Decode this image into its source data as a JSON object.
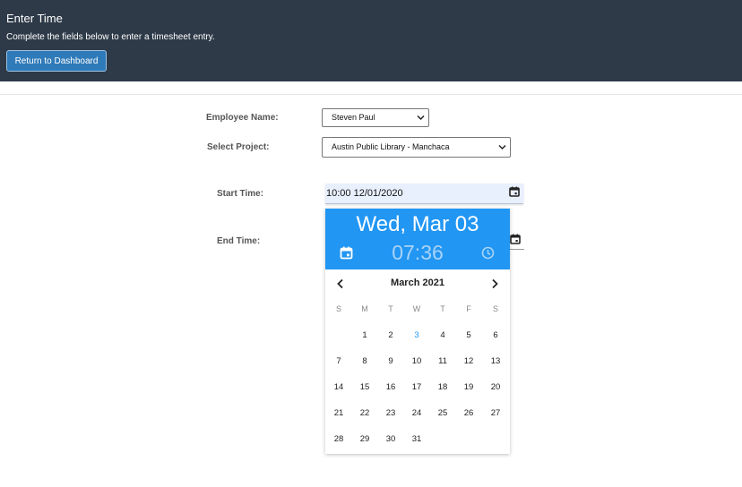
{
  "header": {
    "title": "Enter Time",
    "subtitle": "Complete the fields below to enter a timesheet entry.",
    "dashboard_button": "Return to Dashboard"
  },
  "form": {
    "employee_label": "Employee Name:",
    "employee_value": "Steven Paul",
    "project_label": "Select Project:",
    "project_value": "Austin Public Library - Manchaca",
    "start_label": "Start Time:",
    "start_value": "10:00 12/01/2020",
    "end_label": "End Time:"
  },
  "picker": {
    "header_date": "Wed, Mar 03",
    "header_time": "07:36",
    "month_label": "March 2021",
    "weekdays": [
      "S",
      "M",
      "T",
      "W",
      "T",
      "F",
      "S"
    ],
    "first_weekday": 1,
    "days": [
      "1",
      "2",
      "3",
      "4",
      "5",
      "6",
      "7",
      "8",
      "9",
      "10",
      "11",
      "12",
      "13",
      "14",
      "15",
      "16",
      "17",
      "18",
      "19",
      "20",
      "21",
      "22",
      "23",
      "24",
      "25",
      "26",
      "27",
      "28",
      "29",
      "30",
      "31"
    ],
    "highlighted_day": "3",
    "highlight_color": "#2196f3",
    "header_color": "#2196f3"
  }
}
